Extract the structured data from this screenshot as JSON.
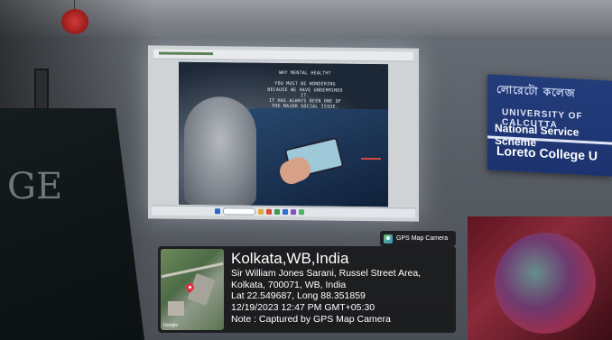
{
  "slide": {
    "line1": "WHY MENTAL HEALTH?",
    "line2": "YOU MUST BE WONDERING",
    "line3": "BECAUSE WE HAVE UNDERMINED",
    "line4": "IT.",
    "line5": "IT HAS ALWAYS BEEN ONE OF",
    "line6": "THE MAJOR SOCIAL ISSUE."
  },
  "banner": {
    "line1": "লোরেটো কলেজ",
    "line2": "UNIVERSITY OF CALCUTTA",
    "line3": "National Service Scheme",
    "line4": "Loreto College U"
  },
  "board": {
    "chalk": "GE"
  },
  "gps": {
    "tag": "GPS Map Camera",
    "city": "Kolkata,WB,India",
    "address_line1": "Sir William Jones Sarani, Russel Street Area,",
    "address_line2": "Kolkata, 700071, WB, India",
    "coords": "Lat 22.549687, Long 88.351859",
    "datetime": "12/19/2023 12:47 PM GMT+05:30",
    "note": "Note : Captured by GPS Map Camera",
    "map_credit": "Google"
  },
  "colors": {
    "banner_blue": "#233c7a",
    "pin_red": "#e0333a",
    "overlay": "#121214"
  }
}
